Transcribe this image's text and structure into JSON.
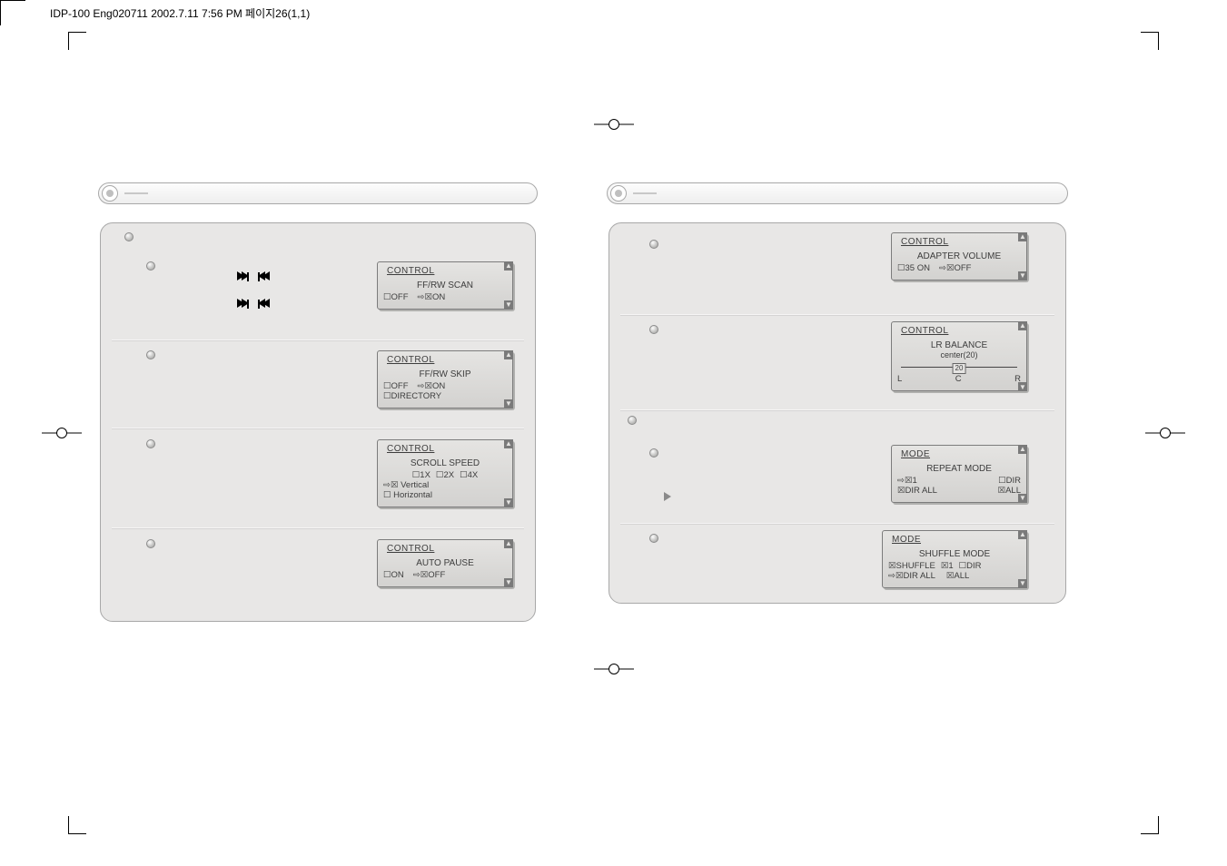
{
  "meta": {
    "header": "IDP-100 Eng020711  2002.7.11 7:56 PM  페이지26(1,1)"
  },
  "left_panel": {
    "rows": [
      {
        "lcd": {
          "tab": "CONTROL",
          "title": "FF/RW SCAN",
          "opt1": "☐OFF",
          "opt2": "⇨☒ON"
        }
      },
      {
        "lcd": {
          "tab": "CONTROL",
          "title": "FF/RW SKIP",
          "opt1": "☐OFF",
          "opt2": "⇨☒ON",
          "opt3": "☐DIRECTORY"
        }
      },
      {
        "lcd": {
          "tab": "CONTROL",
          "title": "SCROLL SPEED",
          "line1a": "☐1X",
          "line1b": "☐2X",
          "line1c": "☐4X",
          "line2": "⇨☒ Vertical",
          "line3": "☐ Horizontal"
        }
      },
      {
        "lcd": {
          "tab": "CONTROL",
          "title": "AUTO PAUSE",
          "opt1": "☐ON",
          "opt2": "⇨☒OFF"
        }
      }
    ]
  },
  "right_panel": {
    "rows": [
      {
        "lcd": {
          "tab": "CONTROL",
          "title": "ADAPTER VOLUME",
          "opt1": "☐35 ON",
          "opt2": "⇨☒OFF"
        }
      },
      {
        "lcd": {
          "tab": "CONTROL",
          "title1": "LR BALANCE",
          "title2": "center(20)",
          "scale_l": "L",
          "scale_c": "C",
          "scale_r": "R",
          "scale_val": "20"
        }
      },
      {
        "lcd": {
          "tab": "MODE",
          "title": "REPEAT MODE",
          "r1a": "⇨☒1",
          "r1b": "☐DIR",
          "r2a": "☒DIR ALL",
          "r2b": "☒ALL"
        }
      },
      {
        "lcd": {
          "tab": "MODE",
          "title": "SHUFFLE MODE",
          "r1a": "☒SHUFFLE",
          "r1b": "☒1",
          "r1c": "☐DIR",
          "r2a": "⇨☒DIR ALL",
          "r2b": "☒ALL"
        }
      }
    ]
  }
}
